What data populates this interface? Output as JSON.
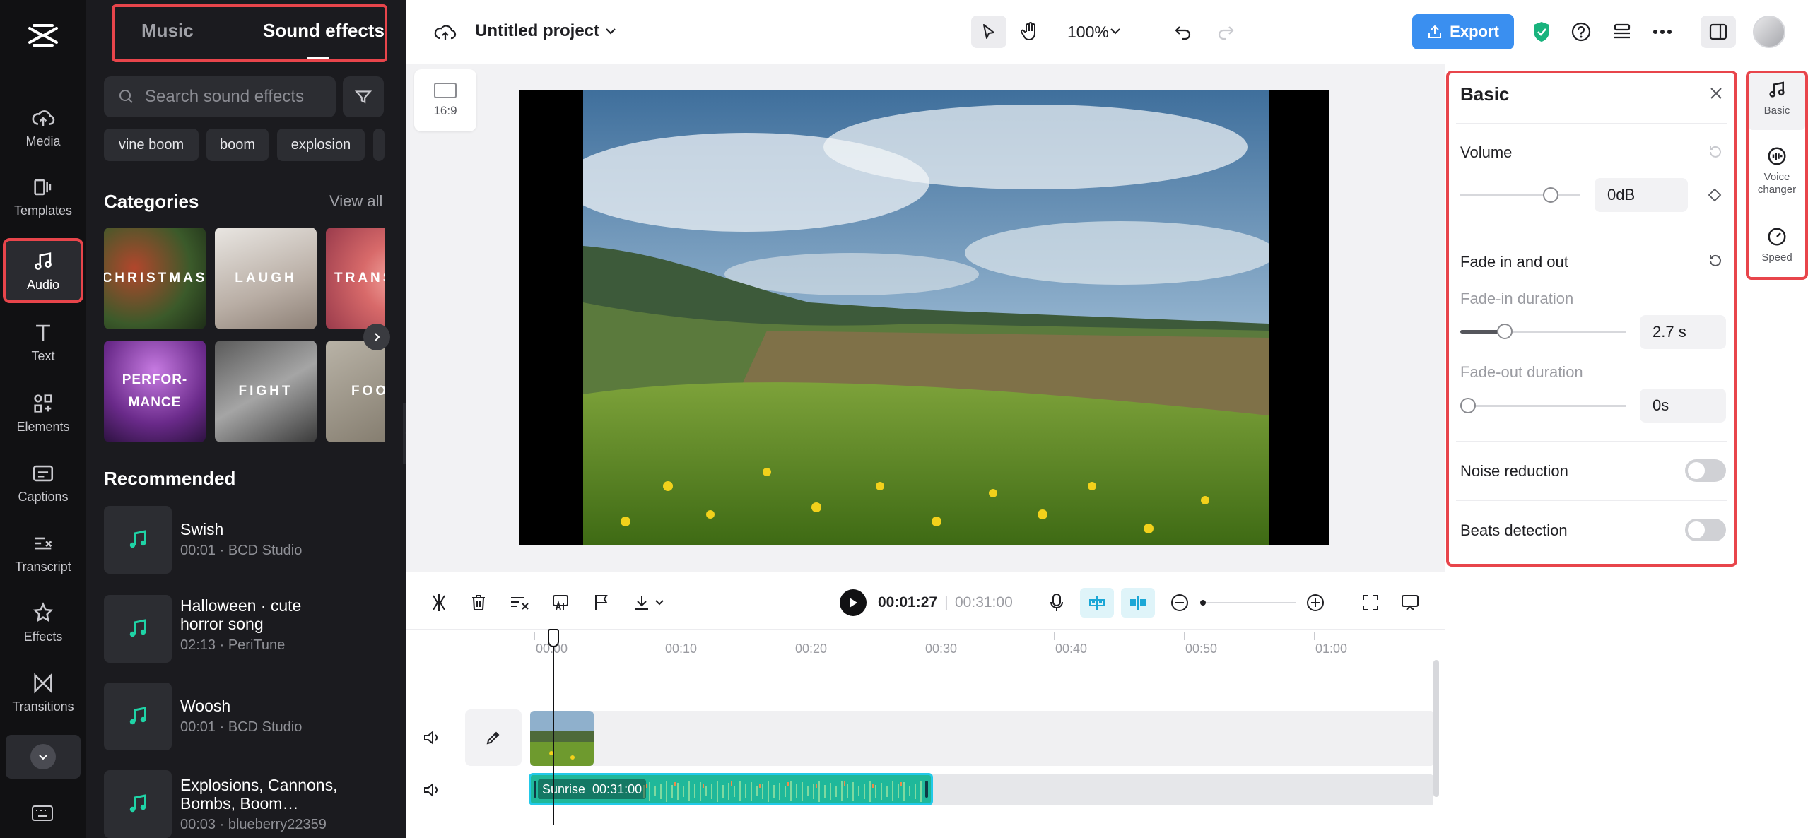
{
  "rail": {
    "items": [
      {
        "label": "Media",
        "icon": "cloud-upload-icon"
      },
      {
        "label": "Templates",
        "icon": "templates-icon"
      },
      {
        "label": "Audio",
        "icon": "music-note-icon"
      },
      {
        "label": "Text",
        "icon": "text-icon"
      },
      {
        "label": "Elements",
        "icon": "elements-icon"
      },
      {
        "label": "Captions",
        "icon": "captions-icon"
      },
      {
        "label": "Transcript",
        "icon": "transcript-icon"
      },
      {
        "label": "Effects",
        "icon": "effects-icon"
      },
      {
        "label": "Transitions",
        "icon": "transitions-icon"
      }
    ]
  },
  "library": {
    "tabs": {
      "music": "Music",
      "sound_effects": "Sound effects"
    },
    "search_placeholder": "Search sound effects",
    "chips": [
      "vine boom",
      "boom",
      "explosion"
    ],
    "categories_title": "Categories",
    "view_all": "View all",
    "categories": [
      "CHRISTMAS",
      "LAUGH",
      "TRANSI",
      "PERFOR-\nMANCE",
      "FIGHT",
      "FOO"
    ],
    "recommended_title": "Recommended",
    "recommended": [
      {
        "name": "Swish",
        "meta": "00:01 · BCD Studio"
      },
      {
        "name": "Halloween · cute horror song",
        "meta": "02:13 · PeriTune"
      },
      {
        "name": "Woosh",
        "meta": "00:01 · BCD Studio"
      },
      {
        "name": "Explosions, Cannons, Bombs, Boom…",
        "meta": "00:03 · blueberry22359"
      }
    ]
  },
  "topbar": {
    "project_name": "Untitled project",
    "zoom": "100%",
    "export_label": "Export"
  },
  "canvas": {
    "ratio_label": "16:9"
  },
  "basic": {
    "title": "Basic",
    "volume_label": "Volume",
    "volume_value": "0dB",
    "volume_level": 0.75,
    "fade_label": "Fade in and out",
    "fade_in_label": "Fade-in duration",
    "fade_in_value": "2.7 s",
    "fade_in_level": 0.27,
    "fade_out_label": "Fade-out duration",
    "fade_out_value": "0s",
    "fade_out_level": 0,
    "noise_label": "Noise reduction",
    "noise_on": false,
    "beats_label": "Beats detection",
    "beats_on": false
  },
  "right_tabs": [
    {
      "label": "Basic",
      "icon": "music-note-icon"
    },
    {
      "label": "Voice changer",
      "icon": "voice-changer-icon"
    },
    {
      "label": "Speed",
      "icon": "speed-icon"
    }
  ],
  "playback": {
    "current": "00:01:27",
    "separator": "|",
    "total": "00:31:00"
  },
  "timeline": {
    "ticks": [
      "00:00",
      "00:10",
      "00:20",
      "00:30",
      "00:40",
      "00:50",
      "01:00"
    ],
    "audio_clip": {
      "name": "Sunrise",
      "duration": "00:31:00"
    }
  },
  "colors": {
    "accent": "#3a8ff0",
    "highlight": "#e8454b",
    "audio_clip": "#1fb89a"
  }
}
